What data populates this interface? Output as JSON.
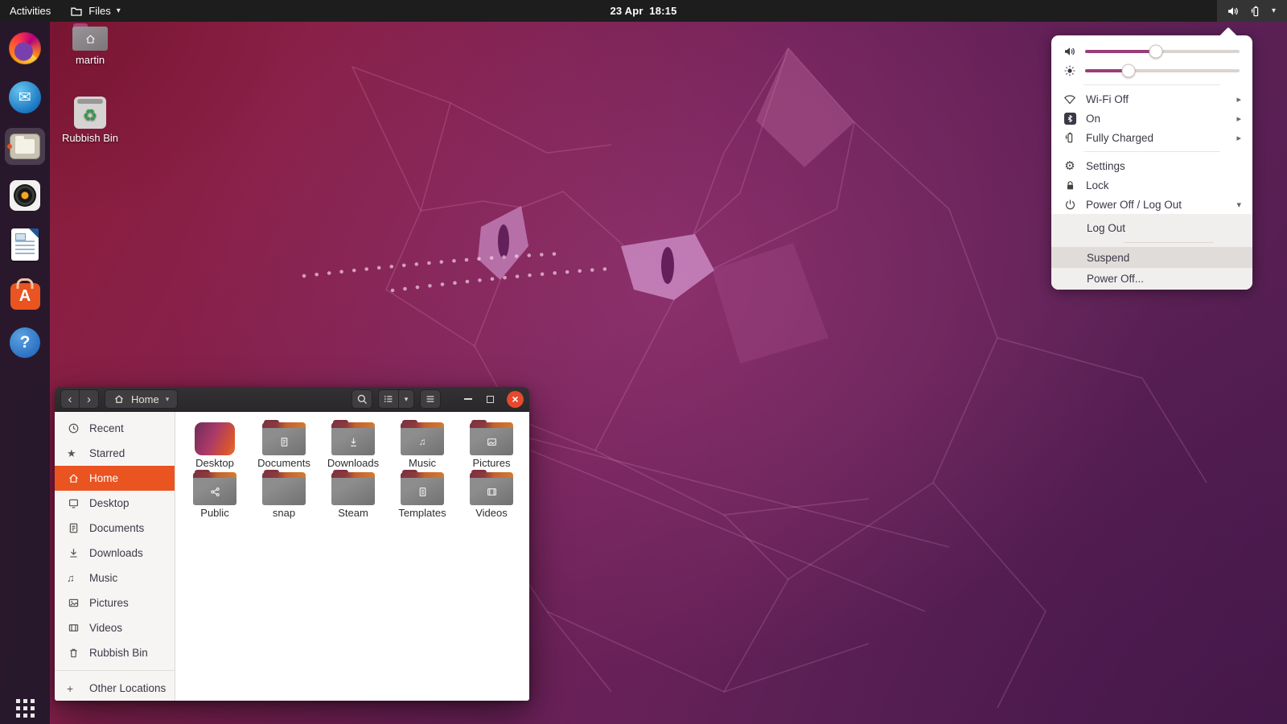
{
  "topbar": {
    "activities_label": "Activities",
    "app_name": "Files",
    "clock": "23 Apr  18:15"
  },
  "icons": {
    "caret_down": "▾",
    "chevron_right": "▸",
    "back": "‹",
    "forward": "›",
    "close": "×",
    "star": "★",
    "music_note": "♫",
    "gear": "⚙",
    "recycle": "♻",
    "plus": "+",
    "envelope": "✉",
    "question_mark": "?",
    "software_letter": "A"
  },
  "desktop_icons": {
    "home_folder": "martin",
    "trash": "Rubbish Bin"
  },
  "files_window": {
    "location": "Home",
    "sidebar": [
      {
        "label": "Recent"
      },
      {
        "label": "Starred"
      },
      {
        "label": "Home",
        "selected": true
      },
      {
        "label": "Desktop"
      },
      {
        "label": "Documents"
      },
      {
        "label": "Downloads"
      },
      {
        "label": "Music"
      },
      {
        "label": "Pictures"
      },
      {
        "label": "Videos"
      },
      {
        "label": "Rubbish Bin"
      },
      {
        "label": "Other Locations"
      }
    ],
    "folders": [
      {
        "name": "Desktop"
      },
      {
        "name": "Documents"
      },
      {
        "name": "Downloads"
      },
      {
        "name": "Music"
      },
      {
        "name": "Pictures"
      },
      {
        "name": "Public"
      },
      {
        "name": "snap"
      },
      {
        "name": "Steam"
      },
      {
        "name": "Templates"
      },
      {
        "name": "Videos"
      }
    ]
  },
  "system_menu": {
    "volume_percent": 46,
    "brightness_percent": 28,
    "status_items": [
      {
        "label": "Wi-Fi Off"
      },
      {
        "label": "On"
      },
      {
        "label": "Fully Charged"
      }
    ],
    "actions": [
      {
        "label": "Settings"
      },
      {
        "label": "Lock"
      },
      {
        "label": "Power Off / Log Out"
      }
    ],
    "power_submenu": {
      "log_out": "Log Out",
      "suspend": "Suspend",
      "power_off": "Power Off..."
    }
  },
  "colors": {
    "accent_orange": "#E95420",
    "slider_purple": "#993d78",
    "topbar_bg": "#1d1d1d",
    "suspend_highlight": "#dfdcda"
  }
}
